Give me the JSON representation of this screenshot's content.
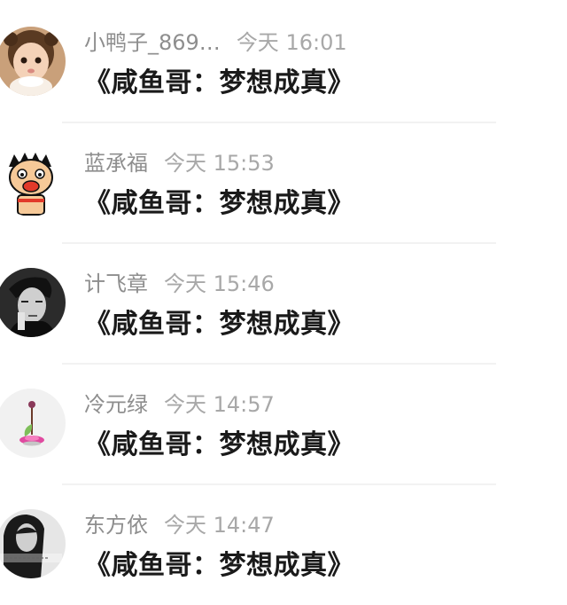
{
  "messages": [
    {
      "name": "小鸭子_869…",
      "time": "今天 16:01",
      "text": "《咸鱼哥：梦想成真》",
      "avatar_icon": "baby-girl-avatar-icon"
    },
    {
      "name": "蓝承福",
      "time": "今天 15:53",
      "text": "《咸鱼哥：梦想成真》",
      "avatar_icon": "cartoon-boy-avatar-icon"
    },
    {
      "name": "计飞章",
      "time": "今天 15:46",
      "text": "《咸鱼哥：梦想成真》",
      "avatar_icon": "bw-man-portrait-avatar-icon"
    },
    {
      "name": "冷元绿",
      "time": "今天 14:57",
      "text": "《咸鱼哥：梦想成真》",
      "avatar_icon": "flower-avatar-icon"
    },
    {
      "name": "东方依",
      "time": "今天 14:47",
      "text": "《咸鱼哥：梦想成真》",
      "avatar_icon": "bw-woman-portrait-avatar-icon"
    }
  ],
  "colors": {
    "name_text": "#8e8e8e",
    "time_text": "#a8a8a8",
    "message_text": "#1a1a1a",
    "divider": "#f2f2f2"
  }
}
